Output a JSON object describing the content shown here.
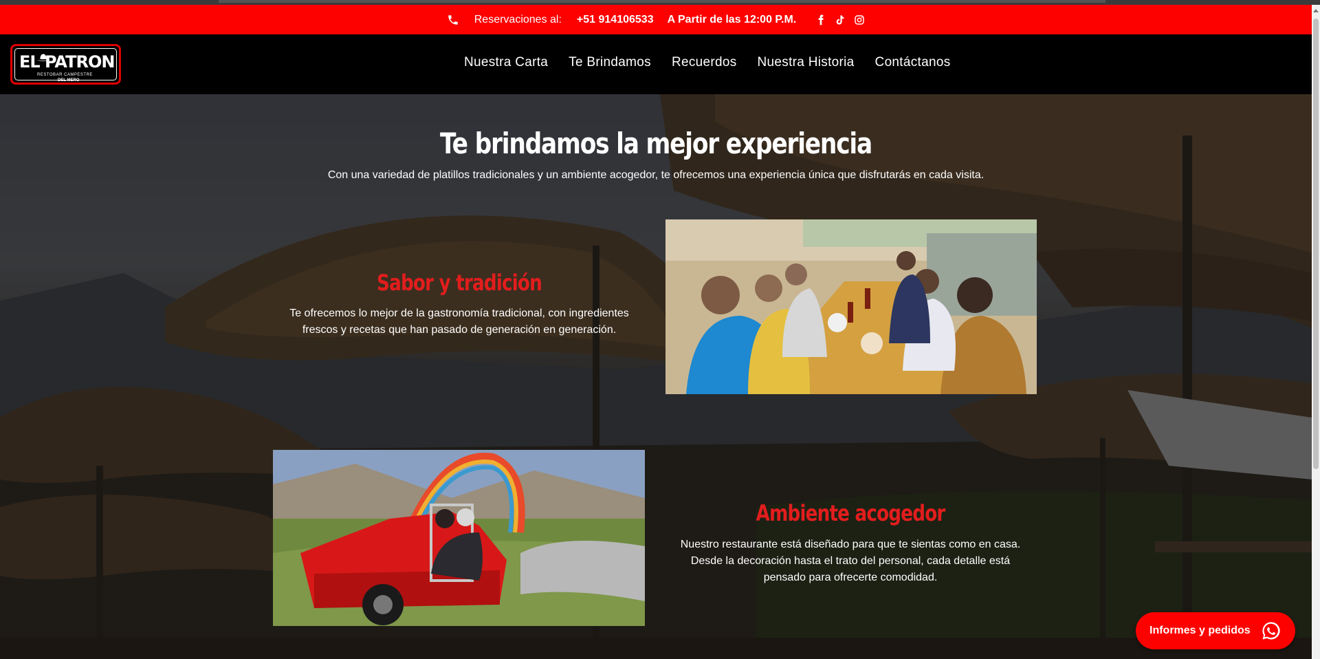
{
  "topbar": {
    "reservations_label": "Reservaciones al:",
    "phone": "+51 914106533",
    "hours": "A Partir de las 12:00 P.M.",
    "icons": [
      "phone-icon",
      "facebook-icon",
      "tiktok-icon",
      "instagram-icon"
    ]
  },
  "logo": {
    "brand": "EL PATRON",
    "tagline": "RESTOBAR CAMPESTRE",
    "location": "DEL MERO"
  },
  "nav": {
    "items": [
      {
        "label": "Nuestra Carta"
      },
      {
        "label": "Te Brindamos"
      },
      {
        "label": "Recuerdos"
      },
      {
        "label": "Nuestra Historia"
      },
      {
        "label": "Contáctanos"
      }
    ]
  },
  "hero": {
    "title": "Te brindamos la mejor experiencia",
    "subtitle": "Con una variedad de platillos tradicionales y un ambiente acogedor, te ofrecemos una experiencia única que disfrutarás en cada visita."
  },
  "features": [
    {
      "title": "Sabor y tradición",
      "line1": "Te ofrecemos lo mejor de la gastronomía tradicional, con ingredientes",
      "line2": "frescos y recetas que han pasado de generación en generación."
    },
    {
      "title": "Ambiente acogedor",
      "line1": "Nuestro restaurante está diseñado para que te sientas como en casa.",
      "line2": "Desde la decoración hasta el trato del personal, cada detalle está",
      "line3": "pensado para ofrecerte comodidad."
    }
  ],
  "whatsapp": {
    "label": "Informes y pedidos"
  },
  "colors": {
    "brand_red": "#fd0000",
    "heading_red": "#e21d1d",
    "nav_bg": "#000000",
    "text": "#ffffff"
  }
}
